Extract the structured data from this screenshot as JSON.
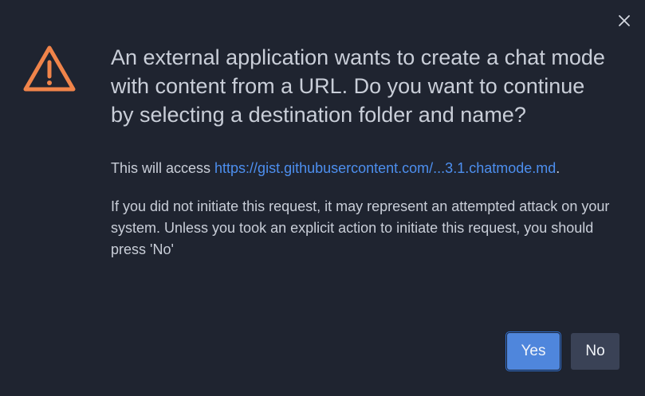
{
  "dialog": {
    "headline": "An external application wants to create a chat mode with content from a URL. Do you want to continue by selecting a destination folder and name?",
    "access_prefix": "This will access ",
    "access_link": "https://gist.githubusercontent.com/...3.1.chatmode.md",
    "access_suffix": ".",
    "warning": "If you did not initiate this request, it may represent an attempted attack on your system. Unless you took an explicit action to initiate this request, you should press 'No'",
    "yes_label": "Yes",
    "no_label": "No",
    "icon": "warning-icon",
    "close_icon": "close-icon"
  },
  "colors": {
    "background": "#1f2430",
    "text": "#c9ced8",
    "link": "#4d8fef",
    "warning_icon": "#f0844a",
    "primary_button": "#4f86dc",
    "secondary_button": "#3a4256"
  }
}
